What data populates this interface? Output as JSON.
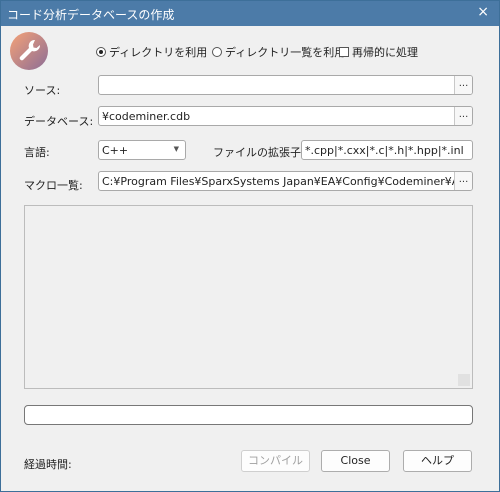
{
  "window": {
    "title": "コード分析データベースの作成",
    "close_glyph": "×"
  },
  "options": {
    "directory": "ディレクトリを利用",
    "directory_list": "ディレクトリ一覧を利用",
    "recursive": "再帰的に処理",
    "selected": "directory",
    "recursive_checked": false
  },
  "form": {
    "source_label": "ソース:",
    "source_value": "",
    "database_label": "データベース:",
    "database_value": "¥codeminer.cdb",
    "language_label": "言語:",
    "language_value": "C++",
    "ext_label": "ファイルの拡張子:",
    "ext_value": "*.cpp|*.cxx|*.c|*.h|*.hpp|*.inl",
    "macro_label": "マクロ一覧:",
    "macro_value": "C:¥Program Files¥SparxSystems Japan¥EA¥Config¥Codeminer¥AtlAfxMacros",
    "browse": "..."
  },
  "progress": {
    "value": 0
  },
  "footer": {
    "elapsed_label": "経過時間:",
    "compile": "コンパイル",
    "close": "Close",
    "help": "ヘルプ"
  },
  "icons": {
    "logo": "wrench-icon"
  },
  "colors": {
    "titlebar": "#4c7ba8",
    "logo_gradient_start": "#f5a277",
    "logo_gradient_end": "#8c6d96"
  }
}
